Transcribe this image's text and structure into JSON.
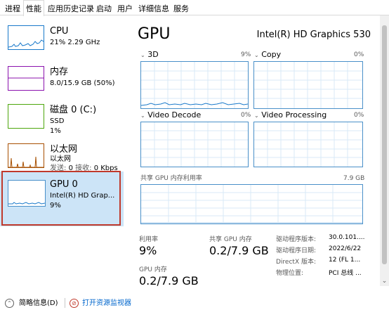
{
  "tabs": [
    "进程",
    "性能",
    "应用历史记录",
    "启动",
    "用户",
    "详细信息",
    "服务"
  ],
  "active_tab": "性能",
  "sidebar": {
    "items": [
      {
        "title": "CPU",
        "sub1": "21% 2.29 GHz",
        "sub2": "",
        "color": "#1979ca"
      },
      {
        "title": "内存",
        "sub1": "8.0/15.9 GB (50%)",
        "sub2": "",
        "color": "#8b12ae"
      },
      {
        "title": "磁盘 0 (C:)",
        "sub1": "SSD",
        "sub2": "1%",
        "color": "#4da60c"
      },
      {
        "title": "以太网",
        "sub1": "以太网",
        "sub2": "",
        "color": "#a74f01"
      },
      {
        "title": "GPU 0",
        "sub1": "Intel(R) HD Grap...",
        "sub2": "9%",
        "color": "#1979ca"
      }
    ],
    "ethernet_traffic": {
      "send_label": "发送:",
      "send_value": "0",
      "recv_label": "接收:",
      "recv_value": "0 Kbps"
    },
    "selected_index": 4
  },
  "main": {
    "title": "GPU",
    "model": "Intel(R) HD Graphics 530",
    "engines": [
      {
        "label": "3D",
        "percent": "9%"
      },
      {
        "label": "Copy",
        "percent": "0%"
      },
      {
        "label": "Video Decode",
        "percent": "0%"
      },
      {
        "label": "Video Processing",
        "percent": "0%"
      }
    ],
    "shared_memory_caption": "共享 GPU 内存利用率",
    "shared_memory_max": "7.9 GB",
    "stats": {
      "utilization_label": "利用率",
      "utilization_value": "9%",
      "shared_mem_label": "共享 GPU 内存",
      "shared_mem_value": "0.2/7.9 GB",
      "gpu_mem_label": "GPU 内存",
      "gpu_mem_value": "0.2/7.9 GB"
    },
    "driver_info": [
      {
        "key": "驱动程序版本:",
        "value": "30.0.101...."
      },
      {
        "key": "驱动程序日期:",
        "value": "2022/6/22"
      },
      {
        "key": "DirectX 版本:",
        "value": "12 (FL 1..."
      },
      {
        "key": "物理位置:",
        "value": "PCI 总线 ..."
      }
    ]
  },
  "footer": {
    "summary_label": "简略信息(D)",
    "open_monitor_label": "打开资源监视器"
  },
  "colors": {
    "gpu_line": "#1979ca",
    "graph_border": "#4a90c9",
    "grid": "#d9eaf7",
    "selected_bg": "#cce4f7",
    "selection_outline": "#c0392b"
  }
}
